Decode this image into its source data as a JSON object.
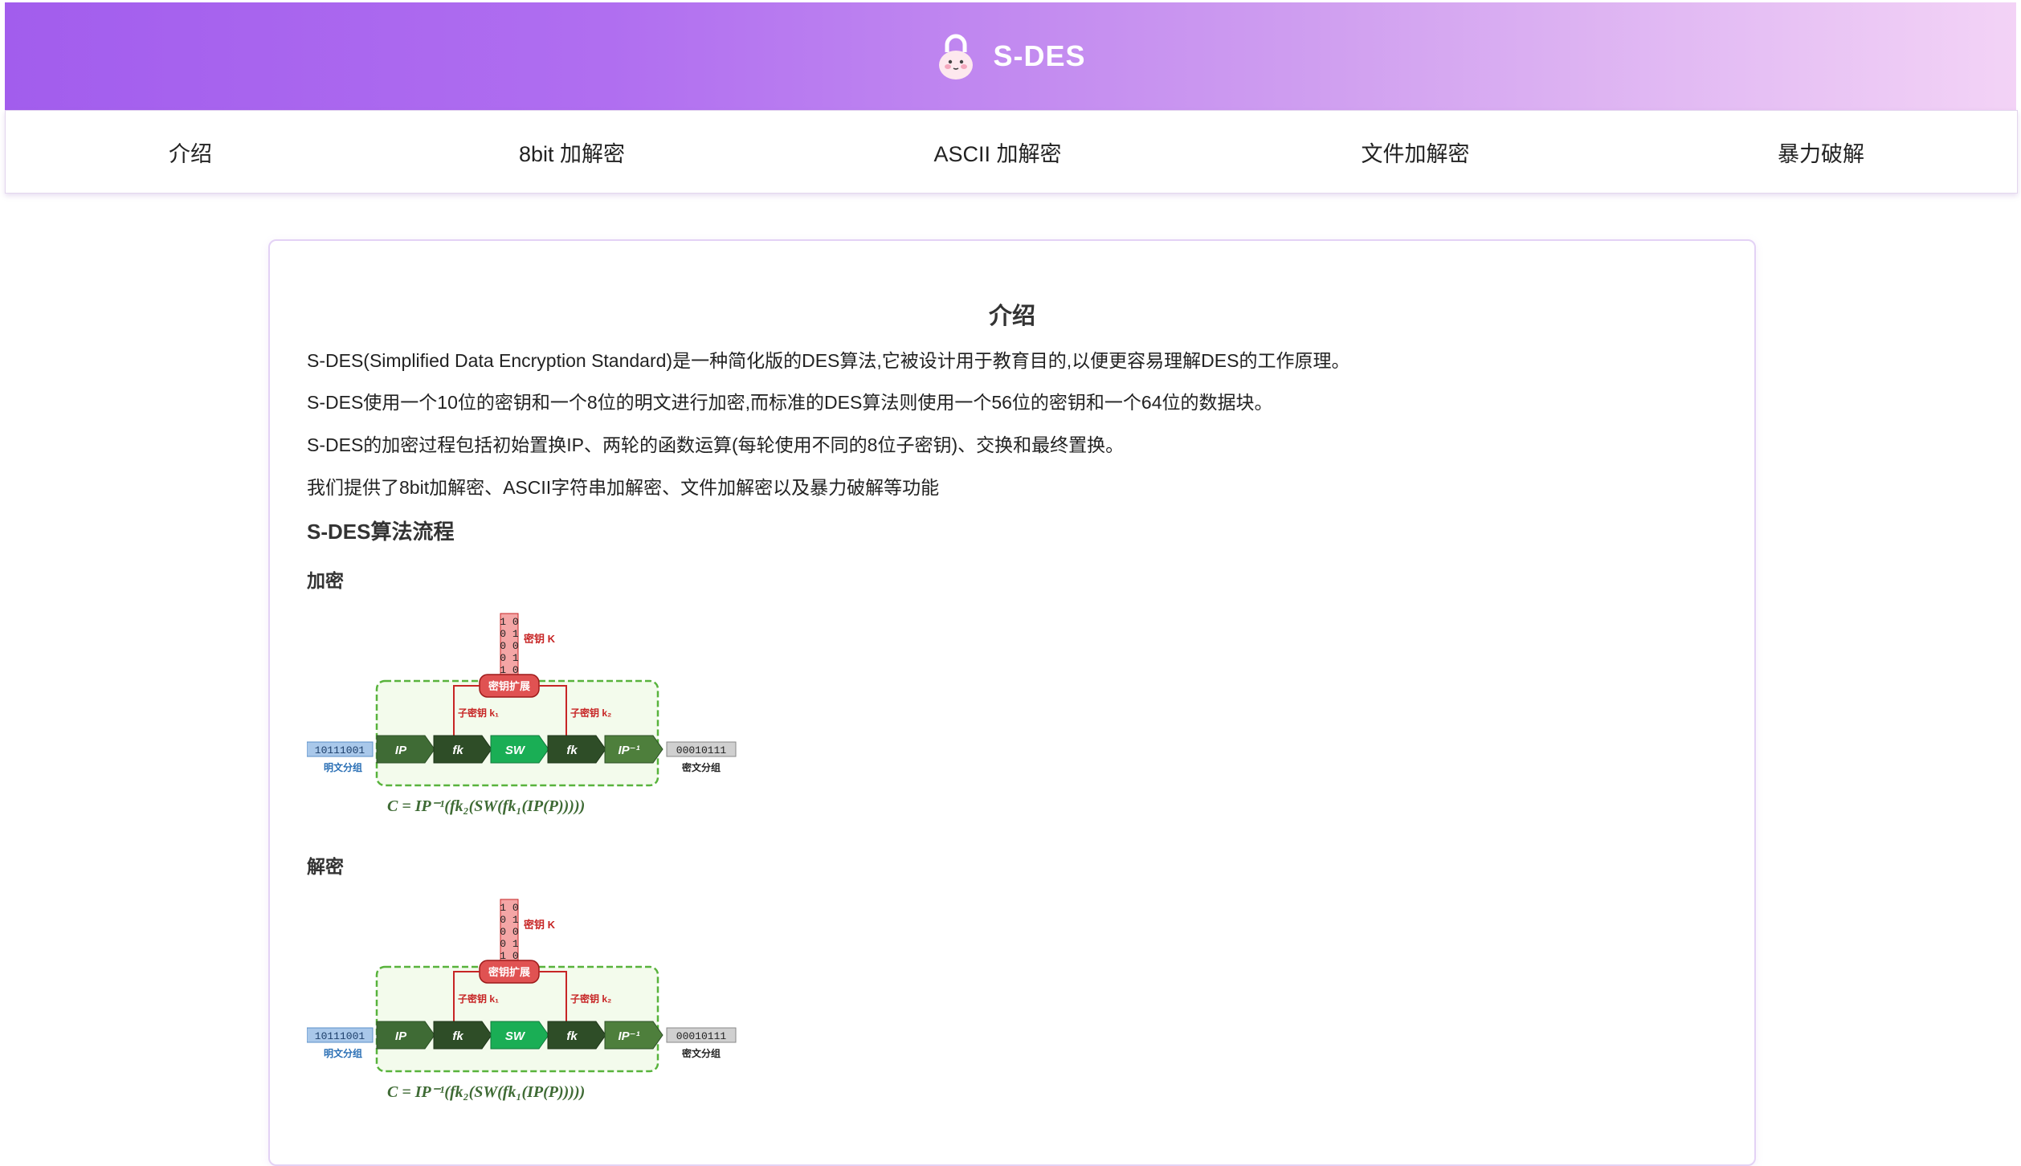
{
  "header": {
    "title": "S-DES",
    "logo_icon": "lock-mascot-icon"
  },
  "nav": {
    "items": [
      "介绍",
      "8bit 加解密",
      "ASCII 加解密",
      "文件加解密",
      "暴力破解"
    ]
  },
  "intro": {
    "title": "介绍",
    "paragraphs": [
      "S-DES(Simplified Data Encryption Standard)是一种简化版的DES算法,它被设计用于教育目的,以便更容易理解DES的工作原理。",
      "S-DES使用一个10位的密钥和一个8位的明文进行加密,而标准的DES算法则使用一个56位的密钥和一个64位的数据块。",
      "S-DES的加密过程包括初始置换IP、两轮的函数运算(每轮使用不同的8位子密钥)、交换和最终置换。",
      "我们提供了8bit加解密、ASCII字符串加解密、文件加解密以及暴力破解等功能"
    ],
    "flow_heading": "S-DES算法流程",
    "encrypt_heading": "加密",
    "decrypt_heading": "解密"
  },
  "diagram": {
    "key_bits": [
      "1 0",
      "0 1",
      "0 0",
      "0 1",
      "1 0"
    ],
    "key_label": "密钥 K",
    "expand_label": "密钥扩展",
    "subkey1_label": "子密钥 k₁",
    "subkey2_label": "子密钥 k₂",
    "plaintext_bits": "10111001",
    "plaintext_label": "明文分组",
    "ciphertext_bits": "00010111",
    "ciphertext_label": "密文分组",
    "stages": [
      "IP",
      "fk",
      "SW",
      "fk",
      "IP⁻¹"
    ],
    "formula": "C = IP⁻¹(fk₂(SW(fk₁(IP(P)))))"
  },
  "colors": {
    "accent": "#a25ded",
    "stage_dark": "#3f6b35",
    "stage_green": "#1aae55",
    "key_red": "#c72525",
    "plain_blue": "#5a8fc8"
  }
}
